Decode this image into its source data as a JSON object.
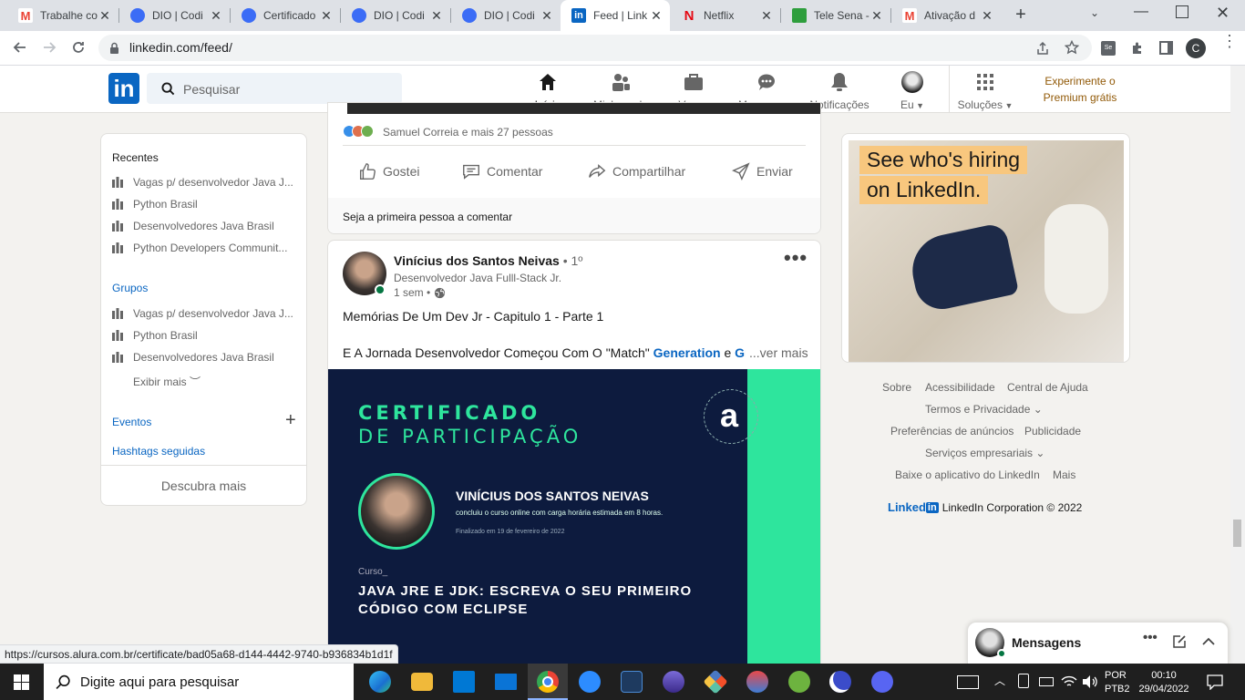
{
  "browser": {
    "tabs": [
      {
        "label": "Trabalhe co",
        "icon": "gmail-icon"
      },
      {
        "label": "DIO | Codi",
        "icon": "dio-icon"
      },
      {
        "label": "Certificado",
        "icon": "dio-icon"
      },
      {
        "label": "DIO | Codi",
        "icon": "dio-icon"
      },
      {
        "label": "DIO | Codi",
        "icon": "dio-icon"
      },
      {
        "label": "Feed | Link",
        "icon": "linkedin-icon"
      },
      {
        "label": "Netflix",
        "icon": "netflix-icon"
      },
      {
        "label": "Tele Sena -",
        "icon": "telesena-icon"
      },
      {
        "label": "Ativação d",
        "icon": "gmail-icon"
      }
    ],
    "url": "linkedin.com/feed/",
    "profile_initial": "C"
  },
  "nav": {
    "search_placeholder": "Pesquisar",
    "items": [
      {
        "label": "Início",
        "icon": "home-icon"
      },
      {
        "label": "Minha rede",
        "icon": "network-icon"
      },
      {
        "label": "Vagas",
        "icon": "briefcase-icon"
      },
      {
        "label": "Mensagens",
        "icon": "chat-icon"
      },
      {
        "label": "Notificações",
        "icon": "bell-icon"
      },
      {
        "label": "Eu",
        "icon": "avatar-icon"
      },
      {
        "label": "Soluções",
        "icon": "grid-icon"
      }
    ],
    "premium_line1": "Experimente o",
    "premium_line2": "Premium grátis"
  },
  "sidebar": {
    "recent_title": "Recentes",
    "recent": [
      "Vagas p/ desenvolvedor Java J...",
      "Python Brasil",
      "Desenvolvedores Java Brasil",
      "Python Developers Communit..."
    ],
    "groups_title": "Grupos",
    "groups": [
      "Vagas p/ desenvolvedor Java J...",
      "Python Brasil",
      "Desenvolvedores Java Brasil"
    ],
    "show_more": "Exibir mais",
    "events": "Eventos",
    "hashtags": "Hashtags seguidas",
    "discover": "Descubra mais"
  },
  "post1": {
    "reactions": "Samuel Correia e mais 27 pessoas",
    "actions": [
      "Gostei",
      "Comentar",
      "Compartilhar",
      "Enviar"
    ],
    "first_comment": "Seja a primeira pessoa a comentar"
  },
  "post2": {
    "author": "Vinícius dos Santos Neivas",
    "degree": "• 1º",
    "headline": "Desenvolvedor Java Fulll-Stack Jr.",
    "time": "1 sem •",
    "text1": "Memórias De Um Dev Jr - Capitulo 1 - Parte 1",
    "text2_pre": "E A Jornada Desenvolvedor Começou Com O \"Match\" ",
    "text2_link1": "Generation",
    "text2_mid": " e ",
    "text2_link2": "Gru",
    "see_more": "...ver mais",
    "cert": {
      "title1": "CERTIFICADO",
      "title2": "DE PARTICIPAÇÃO",
      "logo": "a",
      "name": "VINÍCIUS DOS SANTOS NEIVAS",
      "desc": "concluiu o curso online com carga horária estimada em 8 horas.",
      "date": "Finalizado em 19 de fevereiro de 2022",
      "course_label": "Curso_",
      "course1": "JAVA JRE E JDK: ESCREVA O SEU PRIMEIRO",
      "course2": "CÓDIGO COM ECLIPSE",
      "accent": "#2ee59d"
    }
  },
  "ad": {
    "line1": "See who's hiring",
    "line2": "on LinkedIn."
  },
  "footer": {
    "links": [
      "Sobre",
      "Acessibilidade",
      "Central de Ajuda",
      "Termos e Privacidade",
      "Preferências de anúncios",
      "Publicidade",
      "Serviços empresariais",
      "Baixe o aplicativo do LinkedIn",
      "Mais"
    ],
    "brand": "Linked",
    "copyright": "LinkedIn Corporation © 2022"
  },
  "messaging": {
    "label": "Mensagens"
  },
  "status_url": "https://cursos.alura.com.br/certificate/bad05a68-d144-4442-9740-b936834b1d1f",
  "taskbar": {
    "search_placeholder": "Digite aqui para pesquisar",
    "lang1": "POR",
    "lang2": "PTB2",
    "time": "00:10",
    "date": "29/04/2022"
  },
  "colors": {
    "linkedin_blue": "#0a66c2",
    "premium_gold": "#915907",
    "ad_yellow": "#f8c77e"
  }
}
